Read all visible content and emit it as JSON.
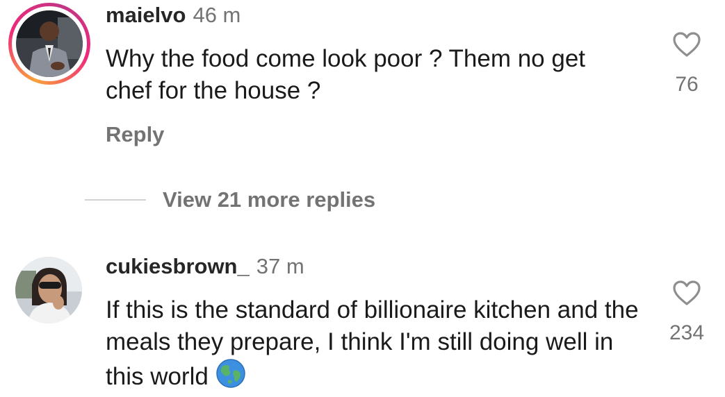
{
  "comments": [
    {
      "username": "maielvo",
      "time": "46 m",
      "text": "Why the food come look poor ? Them no get chef for the house ?",
      "reply_label": "Reply",
      "likes": "76"
    },
    {
      "username": "cukiesbrown_",
      "time": "37 m",
      "text": "If this is the standard of billionaire kitchen and the meals they prepare, I think I'm still doing well in this world",
      "likes": "234"
    }
  ],
  "view_more_replies": "View 21 more replies",
  "icons": {
    "like": "heart-outline-icon",
    "emoji": "globe-earth-emoji"
  },
  "colors": {
    "text": "#1a1a1a",
    "secondary": "#737373",
    "story_ring_start": "#f9a23b",
    "story_ring_end": "#ee2a7b"
  }
}
